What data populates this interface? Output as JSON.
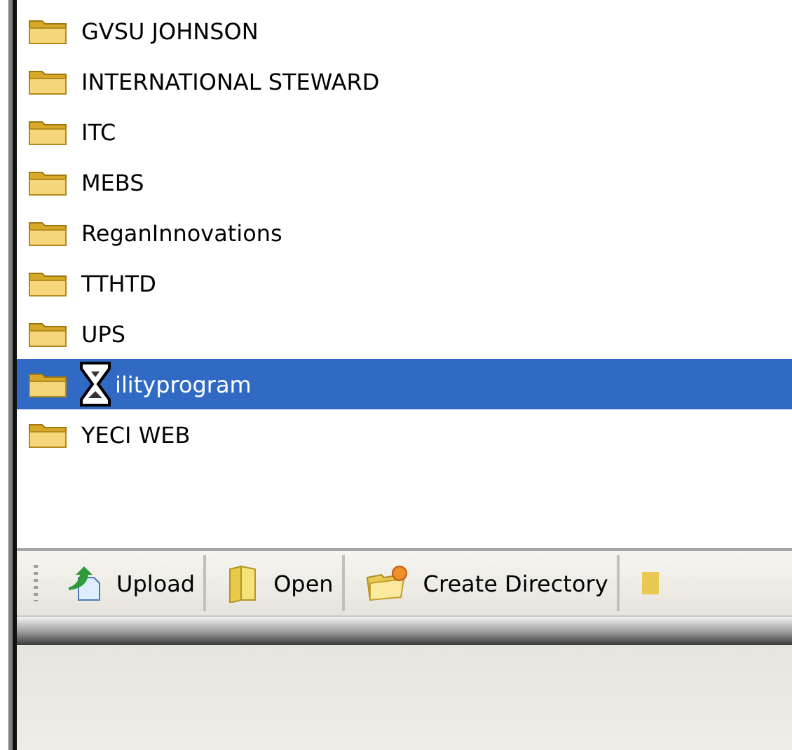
{
  "folders": [
    {
      "name": "GVSU JOHNSON",
      "selected": false
    },
    {
      "name": "INTERNATIONAL STEWARD",
      "selected": false
    },
    {
      "name": "ITC",
      "selected": false
    },
    {
      "name": "MEBS",
      "selected": false
    },
    {
      "name": "ReganInnovations",
      "selected": false
    },
    {
      "name": "TTHTD",
      "selected": false
    },
    {
      "name": "UPS",
      "selected": false
    },
    {
      "name": "ilityprogram",
      "selected": true,
      "busy_cursor": true
    },
    {
      "name": "YECI WEB",
      "selected": false
    }
  ],
  "toolbar": [
    {
      "label": "Upload",
      "kind": "upload"
    },
    {
      "label": "Open",
      "kind": "open"
    },
    {
      "label": "Create Directory",
      "kind": "create"
    }
  ]
}
